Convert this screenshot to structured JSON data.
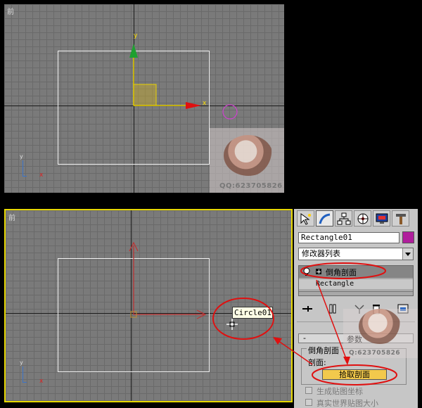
{
  "viewport_top": {
    "label": "前",
    "axis_y_label": "y",
    "axis_x_label": "x",
    "mini_axis_y": "y",
    "mini_axis_x": "x"
  },
  "viewport_bottom": {
    "label": "前",
    "mini_axis_y": "y",
    "mini_axis_x": "x"
  },
  "watermark": {
    "text": "QQ:623705826",
    "text_partial": "Q:623705826"
  },
  "tooltip": {
    "text": "Circle01"
  },
  "panel": {
    "object_name": "Rectangle01",
    "object_color": "#b01e9c",
    "modifier_list": "修改器列表",
    "stack": {
      "modifier": "倒角剖面",
      "base": "Rectangle"
    },
    "rollout_title": "参数",
    "rollout_toggle": "-",
    "group_title": "倒角剖面",
    "profile_label": "剖面:",
    "pick_button": "拾取剖面",
    "checkboxes": [
      "生成贴图坐标",
      "真实世界贴图大小"
    ]
  },
  "colors": {
    "highlight_red": "#e01010",
    "selection_yellow": "#e8d800",
    "pick_button": "#f2c94c"
  }
}
